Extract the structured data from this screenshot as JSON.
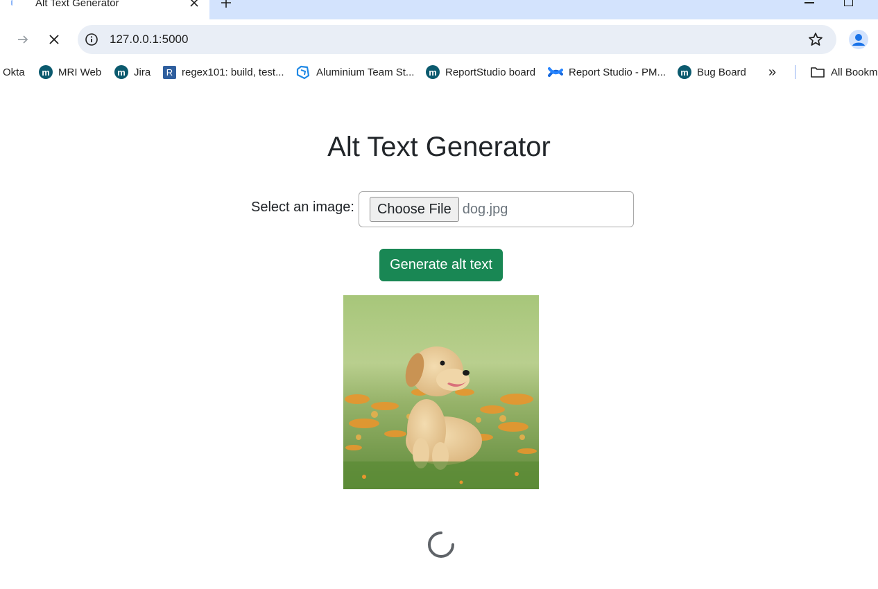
{
  "tab": {
    "title": "Alt Text Generator"
  },
  "toolbar": {
    "url": "127.0.0.1:5000"
  },
  "bookmarks": {
    "items": [
      {
        "label": "Okta"
      },
      {
        "label": "MRI Web"
      },
      {
        "label": "Jira"
      },
      {
        "label": "regex101: build, test..."
      },
      {
        "label": "Aluminium Team St..."
      },
      {
        "label": "ReportStudio board"
      },
      {
        "label": "Report Studio - PM..."
      },
      {
        "label": "Bug Board"
      }
    ],
    "overflow": "»",
    "all_bookmarks": "All Bookm"
  },
  "page": {
    "title": "Alt Text Generator",
    "select_label": "Select an image:",
    "choose_file_label": "Choose File",
    "file_name": "dog.jpg",
    "generate_label": "Generate alt text"
  },
  "colors": {
    "tabstrip": "#d3e3fd",
    "omnibox": "#e9eef6",
    "generate_button": "#198754",
    "bookmark_icon": "#0b5a6e"
  }
}
